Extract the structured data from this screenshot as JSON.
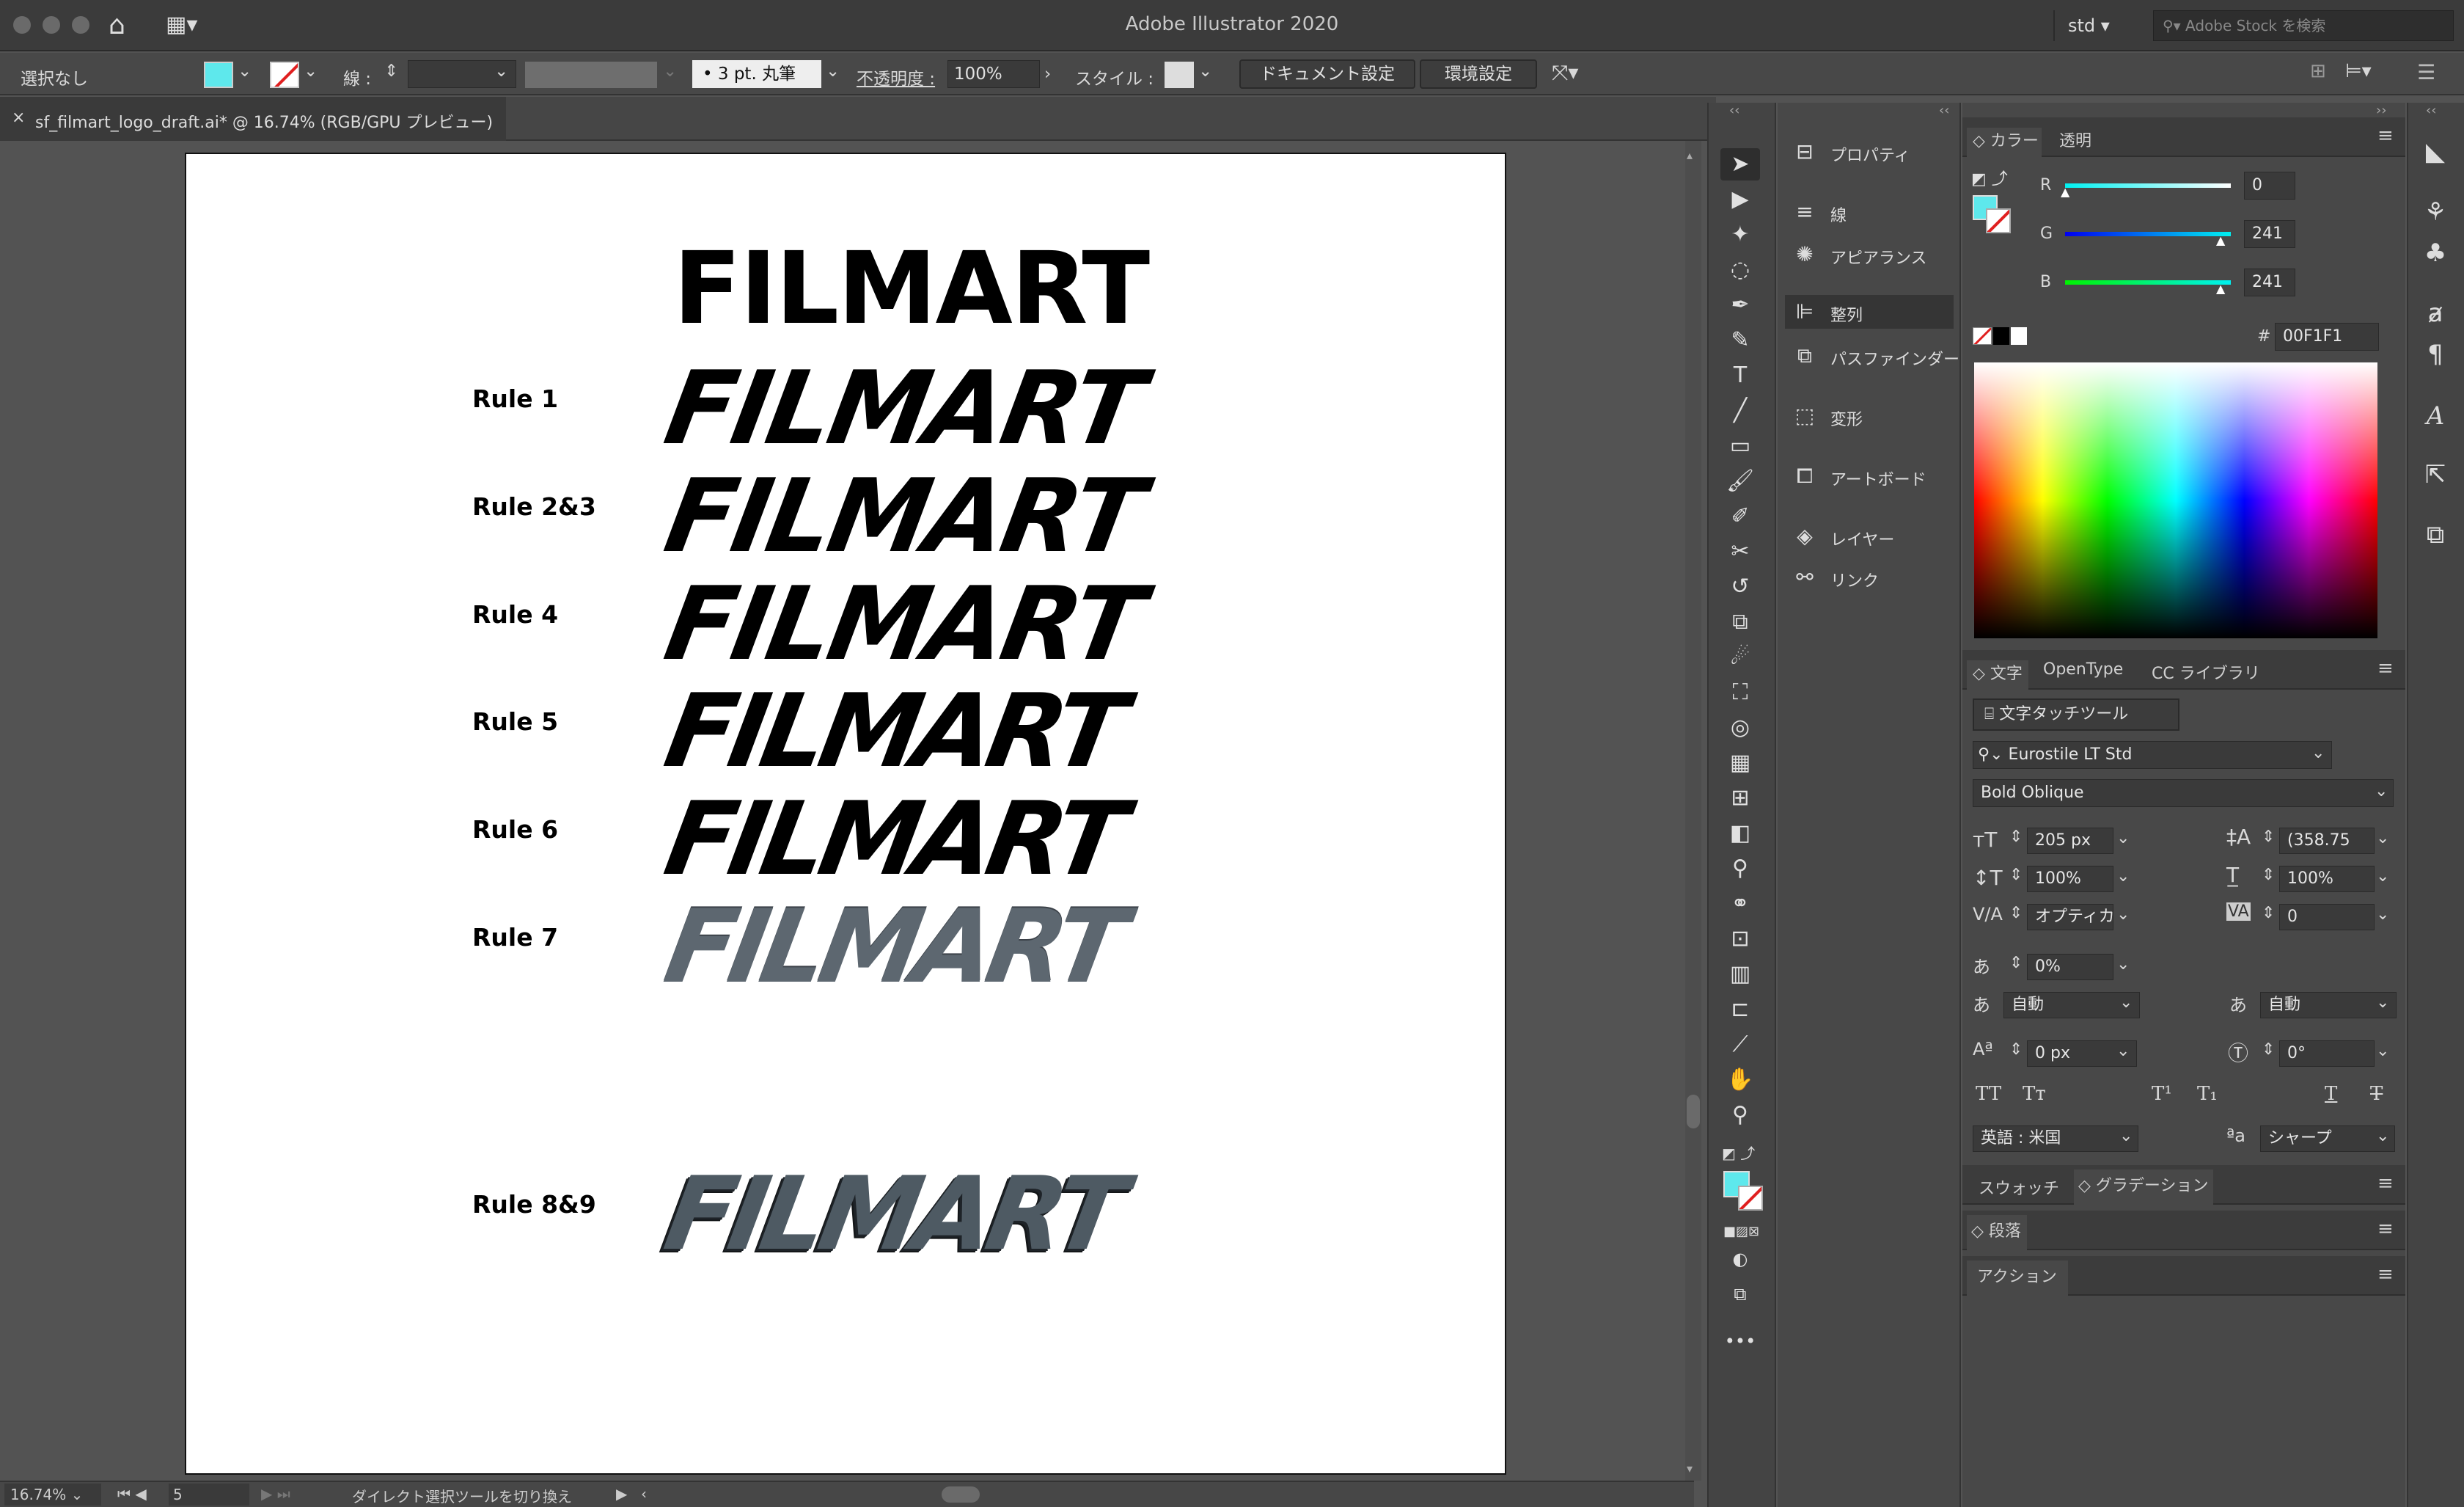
{
  "window": {
    "title": "Adobe Illustrator 2020",
    "workspace": "std",
    "stock_search_placeholder": "Adobe Stock を検索"
  },
  "control_bar": {
    "selection": "選択なし",
    "stroke_label": "線 :",
    "stroke_weight": "",
    "brush": "3 pt. 丸筆",
    "opacity_label": "不透明度 :",
    "opacity_value": "100%",
    "style_label": "スタイル :",
    "doc_setup": "ドキュメント設定",
    "preferences": "環境設定"
  },
  "document_tab": {
    "close": "×",
    "name": "sf_filmart_logo_draft.ai* @ 16.74% (RGB/GPU プレビュー)"
  },
  "artboard": {
    "logos": [
      {
        "rule": "",
        "text": "FILMART",
        "style": "plain"
      },
      {
        "rule": "Rule  1",
        "text": "FILMART",
        "style": "italic"
      },
      {
        "rule": "Rule  2&3",
        "text": "FILMART",
        "style": "italic"
      },
      {
        "rule": "Rule  4",
        "text": "FILMART",
        "style": "italic"
      },
      {
        "rule": "Rule  5",
        "text": "FILMART",
        "style": "italic"
      },
      {
        "rule": "Rule  6",
        "text": "FILMART",
        "style": "italic"
      },
      {
        "rule": "Rule  7",
        "text": "FILMART",
        "style": "metal"
      },
      {
        "rule": "Rule  8&9",
        "text": "FILMART",
        "style": "metal-3d"
      }
    ]
  },
  "status_bar": {
    "zoom": "16.74%",
    "artboard_num": "5",
    "tool_hint": "ダイレクト選択ツールを切り換え"
  },
  "panel_strip": [
    {
      "icon": "properties-icon",
      "label": "プロパティ"
    },
    {
      "icon": "stroke-icon",
      "label": "線"
    },
    {
      "icon": "appearance-icon",
      "label": "アピアランス"
    },
    {
      "icon": "align-icon",
      "label": "整列"
    },
    {
      "icon": "pathfinder-icon",
      "label": "パスファインダー"
    },
    {
      "icon": "transform-icon",
      "label": "変形"
    },
    {
      "icon": "artboard-icon",
      "label": "アートボード"
    },
    {
      "icon": "layers-icon",
      "label": "レイヤー"
    },
    {
      "icon": "links-icon",
      "label": "リンク"
    }
  ],
  "color_panel": {
    "tabs": [
      "カラー",
      "透明"
    ],
    "r": "0",
    "g": "241",
    "b": "241",
    "r_label": "R",
    "g_label": "G",
    "b_label": "B",
    "hex_label": "#",
    "hex": "00F1F1",
    "fill_color": "#00F1F1"
  },
  "character_panel": {
    "tabs": [
      "文字",
      "OpenType",
      "CC ライブラリ"
    ],
    "touch_tool": "文字タッチツール",
    "font_family": "Eurostile LT Std",
    "font_style": "Bold Oblique",
    "size": "205 px",
    "leading": "(358.75",
    "vscale": "100%",
    "hscale": "100%",
    "kerning": "オプティカル",
    "tracking": "0",
    "tsume": "0%",
    "aki_left": "自動",
    "aki_right": "自動",
    "baseline": "0 px",
    "rotation": "0°",
    "language": "英語 : 米国",
    "antialias": "シャープ"
  },
  "collapsed_panels": {
    "swatches": "スウォッチ",
    "gradient": "グラデーション",
    "paragraph": "段落",
    "actions": "アクション"
  }
}
